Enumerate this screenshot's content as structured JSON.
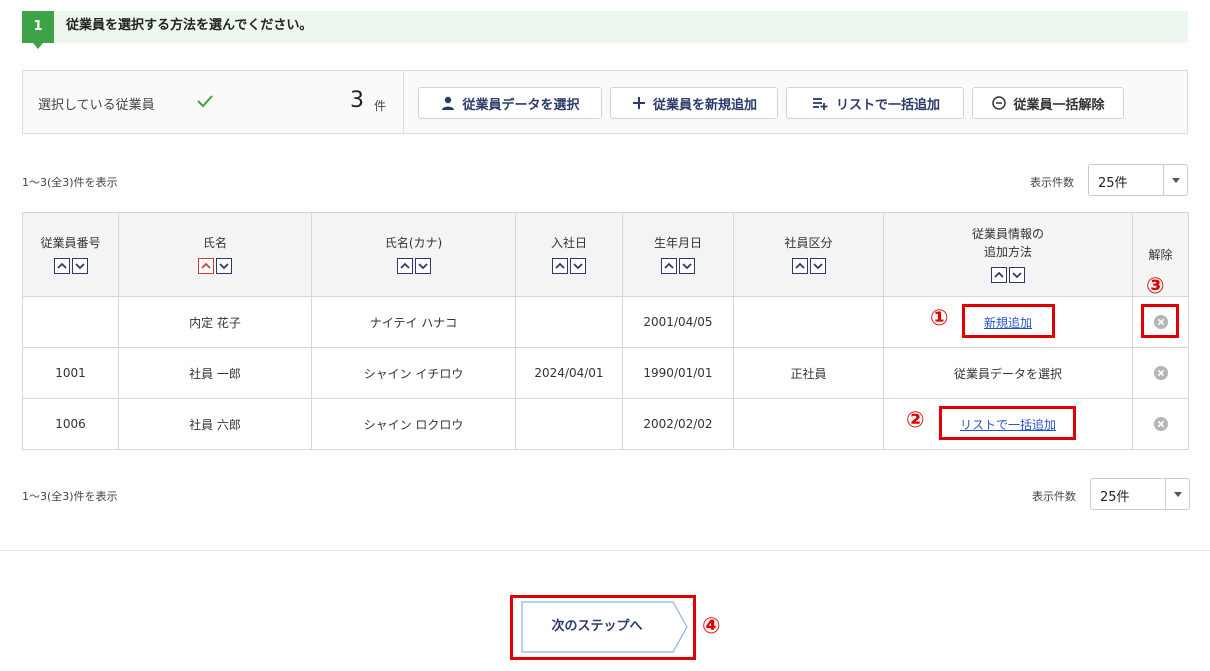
{
  "step": {
    "number": "1",
    "title": "従業員を選択する方法を選んでください。"
  },
  "selection": {
    "label": "選択している従業員",
    "count": "3",
    "unit": "件",
    "buttons": {
      "select_data": "従業員データを選択",
      "add_new": "従業員を新規追加",
      "bulk_list": "リストで一括追加",
      "bulk_remove": "従業員一括解除"
    }
  },
  "pagination": {
    "count_text": "1〜3(全3)件を表示",
    "per_page_label": "表示件数",
    "per_page_value": "25件"
  },
  "table": {
    "headers": {
      "emp_no": "従業員番号",
      "name": "氏名",
      "kana": "氏名(カナ)",
      "join_date": "入社日",
      "birth": "生年月日",
      "category": "社員区分",
      "method_line1": "従業員情報の",
      "method_line2": "追加方法",
      "remove": "解除"
    },
    "rows": [
      {
        "emp_no": "",
        "name": "内定 花子",
        "kana": "ナイテイ ハナコ",
        "join_date": "",
        "birth": "2001/04/05",
        "category": "",
        "method": "新規追加"
      },
      {
        "emp_no": "1001",
        "name": "社員 一郎",
        "kana": "シャイン イチロウ",
        "join_date": "2024/04/01",
        "birth": "1990/01/01",
        "category": "正社員",
        "method": "従業員データを選択"
      },
      {
        "emp_no": "1006",
        "name": "社員 六郎",
        "kana": "シャイン ロクロウ",
        "join_date": "",
        "birth": "2002/02/02",
        "category": "",
        "method": "リストで一括追加"
      }
    ]
  },
  "annotations": {
    "m1": "①",
    "m2": "②",
    "m3": "③",
    "m4": "④",
    "color": "#e00000"
  },
  "next_button": "次のステップへ",
  "colors": {
    "accent_green": "#3ea346",
    "navy": "#2b3a6b",
    "link": "#2a52c9"
  }
}
